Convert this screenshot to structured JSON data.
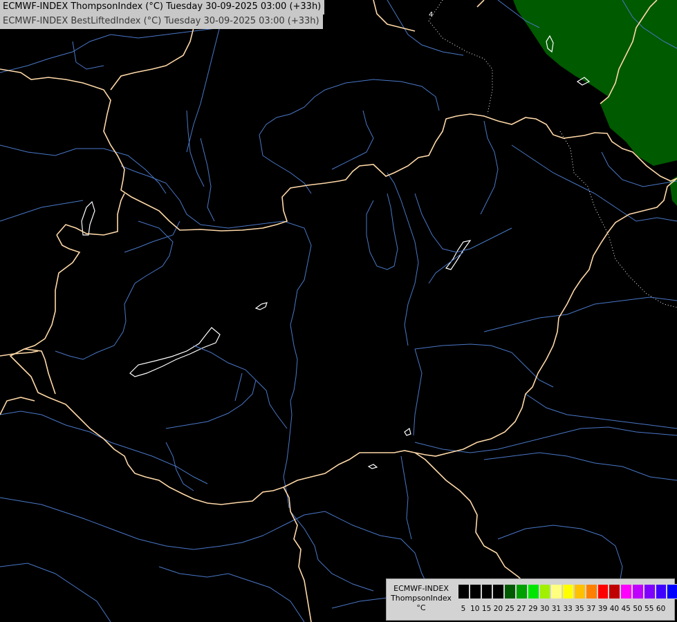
{
  "header": {
    "line1": "ECMWF-INDEX ThompsonIndex (°C) Tuesday 30-09-2025 03:00 (+33h)",
    "line2": "ECMWF-INDEX BestLiftedIndex (°C) Tuesday 30-09-2025 03:00 (+33h)"
  },
  "map": {
    "background_color": "#000000",
    "border_color": "#ffd9a8",
    "river_color": "#4a78c8",
    "lake_outline_color": "#ffffff",
    "contour_color": "#ffffff",
    "field_color_green": "#005a00",
    "field_label": "4"
  },
  "legend": {
    "title_lines": [
      "ECMWF-INDEX",
      "ThompsonIndex",
      "°C"
    ],
    "colors": [
      "#000000",
      "#000000",
      "#000000",
      "#000000",
      "#005a00",
      "#00a000",
      "#00e600",
      "#a0f000",
      "#ffff80",
      "#ffff00",
      "#ffc000",
      "#ff8000",
      "#ff0000",
      "#c00000",
      "#ff00ff",
      "#c000ff",
      "#8000ff",
      "#4000ff",
      "#0000ff"
    ],
    "ticks": [
      "5",
      "10",
      "15",
      "20",
      "25",
      "27",
      "29",
      "30",
      "31",
      "33",
      "35",
      "37",
      "39",
      "40",
      "45",
      "50",
      "55",
      "60"
    ]
  }
}
